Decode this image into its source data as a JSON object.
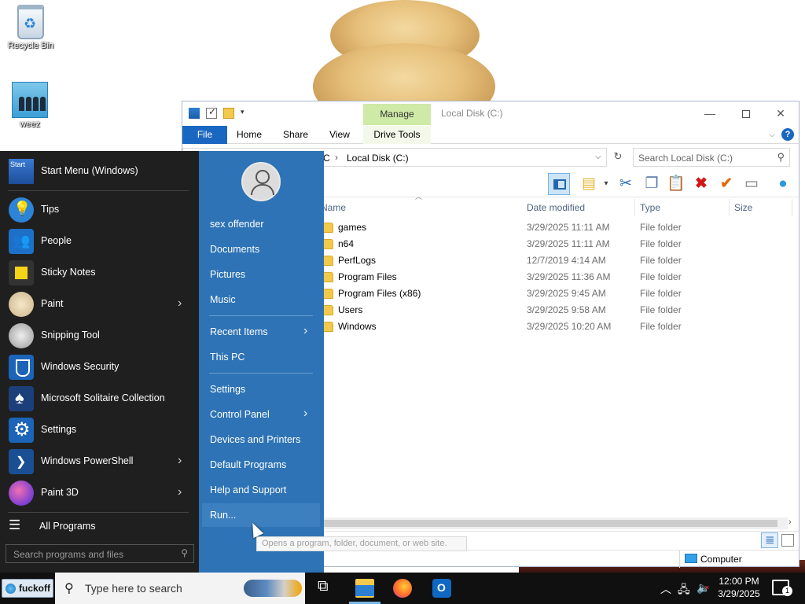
{
  "desktop": {
    "icons": [
      {
        "label": "Recycle Bin"
      },
      {
        "label": "weez"
      }
    ]
  },
  "explorer": {
    "title": "Local Disk (C:)",
    "manage_tab": "Manage",
    "ribbon_tabs": [
      "File",
      "Home",
      "Share",
      "View",
      "Drive Tools"
    ],
    "address": {
      "prefix": "C",
      "separator": "›",
      "location": "Local Disk (C:)"
    },
    "search_placeholder": "Search Local Disk (C:)",
    "columns": [
      "Name",
      "Date modified",
      "Type",
      "Size"
    ],
    "files": [
      {
        "name": "games",
        "date": "3/29/2025 11:11 AM",
        "type": "File folder"
      },
      {
        "name": "n64",
        "date": "3/29/2025 11:11 AM",
        "type": "File folder"
      },
      {
        "name": "PerfLogs",
        "date": "12/7/2019 4:14 AM",
        "type": "File folder"
      },
      {
        "name": "Program Files",
        "date": "3/29/2025 11:36 AM",
        "type": "File folder"
      },
      {
        "name": "Program Files (x86)",
        "date": "3/29/2025 9:45 AM",
        "type": "File folder"
      },
      {
        "name": "Users",
        "date": "3/29/2025 9:58 AM",
        "type": "File folder"
      },
      {
        "name": "Windows",
        "date": "3/29/2025 10:20 AM",
        "type": "File folder"
      }
    ],
    "status_location": "Computer"
  },
  "start_menu": {
    "left_items": [
      {
        "label": "Start Menu (Windows)",
        "icon": "start-menu-icon",
        "arrow": false
      },
      {
        "label": "Tips",
        "icon": "tips-icon",
        "arrow": false
      },
      {
        "label": "People",
        "icon": "people-icon",
        "arrow": false
      },
      {
        "label": "Sticky Notes",
        "icon": "sticky-notes-icon",
        "arrow": false
      },
      {
        "label": "Paint",
        "icon": "paint-icon",
        "arrow": true
      },
      {
        "label": "Snipping Tool",
        "icon": "snipping-tool-icon",
        "arrow": false
      },
      {
        "label": "Windows Security",
        "icon": "shield-icon",
        "arrow": false
      },
      {
        "label": "Microsoft Solitaire Collection",
        "icon": "cards-icon",
        "arrow": false
      },
      {
        "label": "Settings",
        "icon": "gear-icon",
        "arrow": false
      },
      {
        "label": "Windows PowerShell",
        "icon": "powershell-icon",
        "arrow": true
      },
      {
        "label": "Paint 3D",
        "icon": "paint-3d-icon",
        "arrow": true
      }
    ],
    "start_icon_text": "Start",
    "all_programs": "All Programs",
    "search_placeholder": "Search programs and files",
    "right_items": {
      "user": "sex offender",
      "documents": "Documents",
      "pictures": "Pictures",
      "music": "Music",
      "recent": "Recent Items",
      "this_pc": "This PC",
      "settings": "Settings",
      "control_panel": "Control Panel",
      "devices": "Devices and Printers",
      "defaults": "Default Programs",
      "help": "Help and Support",
      "run": "Run..."
    },
    "tooltip": "Opens a program, folder, document, or web site."
  },
  "taskbar": {
    "start_label": "fuckoff",
    "search_placeholder": "Type here to search",
    "time": "12:00 PM",
    "date": "3/29/2025",
    "notification_count": "1"
  }
}
